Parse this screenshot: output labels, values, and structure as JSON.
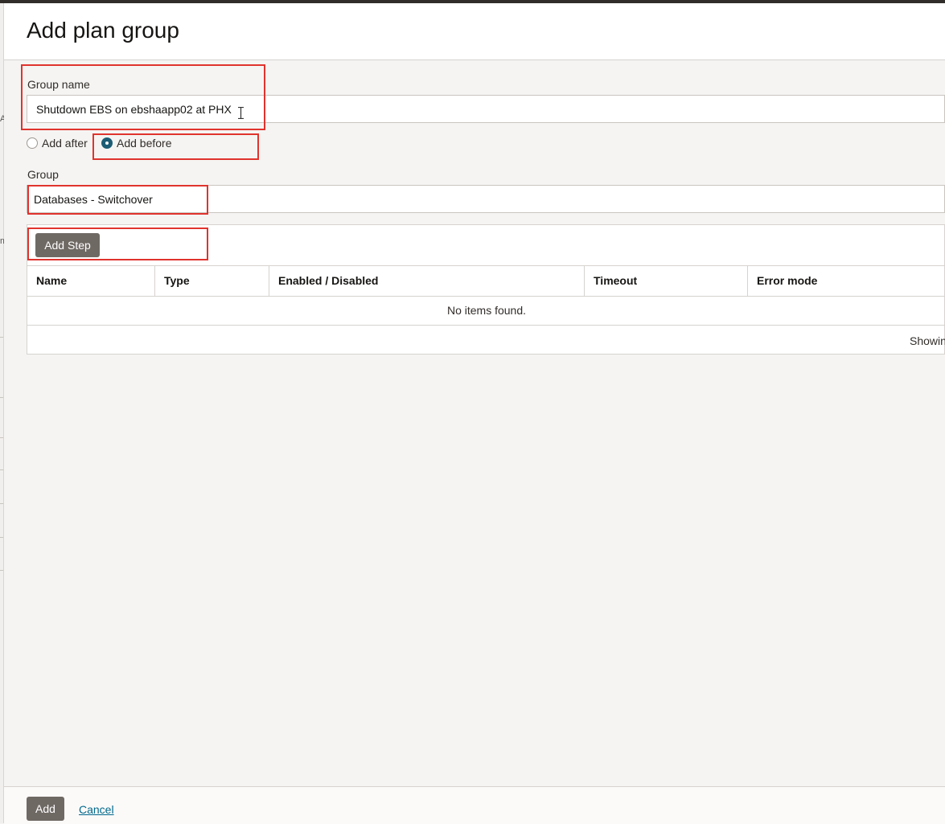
{
  "dialog": {
    "title": "Add plan group"
  },
  "form": {
    "group_name_label": "Group name",
    "group_name_value": "Shutdown EBS on ebshaapp02 at PHX",
    "position_options": [
      {
        "label": "Add after",
        "selected": false
      },
      {
        "label": "Add before",
        "selected": true
      }
    ],
    "group_label": "Group",
    "group_value": "Databases - Switchover"
  },
  "steps": {
    "add_step_label": "Add Step",
    "columns": [
      "Name",
      "Type",
      "Enabled / Disabled",
      "Timeout",
      "Error mode"
    ],
    "rows": [],
    "empty_message": "No items found.",
    "pagination_text": "Showin"
  },
  "footer": {
    "add_label": "Add",
    "cancel_label": "Cancel"
  },
  "colors": {
    "highlight": "#e0332d",
    "radio_selected": "#1c5c74",
    "button_dark": "#6f6964",
    "link": "#00688c"
  },
  "left_strip": {
    "chars": [
      "A",
      "m"
    ]
  }
}
